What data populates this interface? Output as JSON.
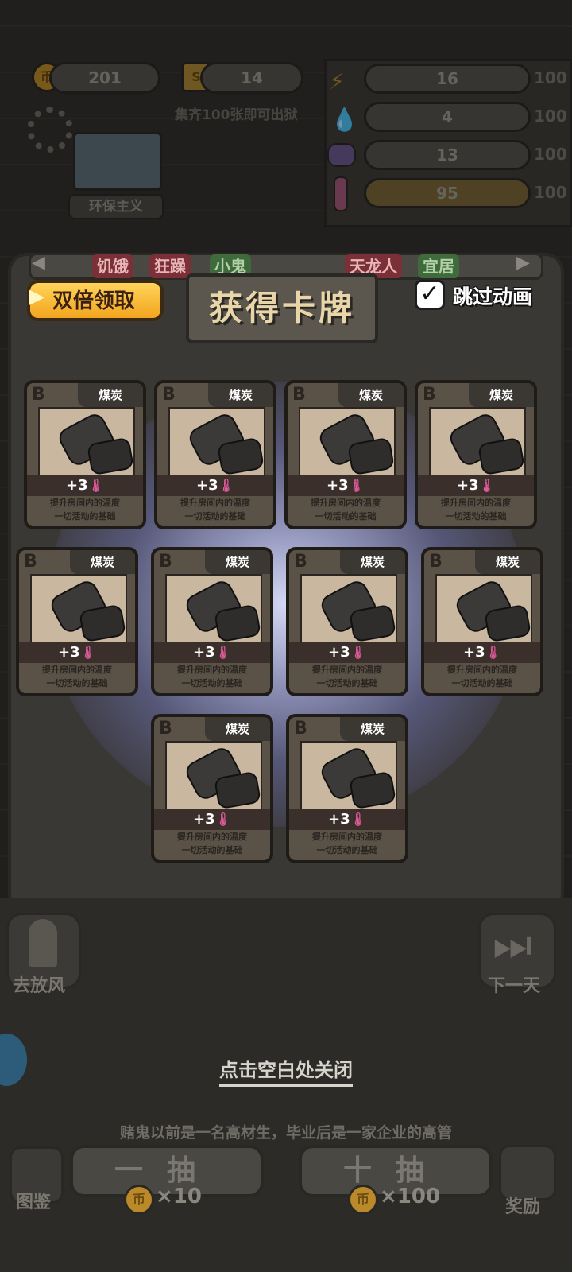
{
  "hud": {
    "coins": "201",
    "cards": "14",
    "collect_hint": "集齐100张即可出狱",
    "character_tag": "环保主义",
    "stats": [
      {
        "icon": "lightning-icon",
        "value": "16",
        "max": "100"
      },
      {
        "icon": "water-drop-icon",
        "value": "4",
        "max": "100"
      },
      {
        "icon": "brain-icon",
        "value": "13",
        "max": "100"
      },
      {
        "icon": "thermometer-icon",
        "value": "95",
        "max": "100"
      }
    ]
  },
  "tags": [
    "饥饿",
    "狂躁",
    "小鬼",
    "天龙人",
    "宜居"
  ],
  "popup": {
    "title": "获得卡牌",
    "double_reward": "双倍领取",
    "skip_animation": "跳过动画",
    "close_hint": "点击空白处关闭"
  },
  "cards": [
    {
      "grade": "B",
      "name": "煤炭",
      "effect": "+3",
      "desc1": "提升房间内的温度",
      "desc2": "一切活动的基础"
    },
    {
      "grade": "B",
      "name": "煤炭",
      "effect": "+3",
      "desc1": "提升房间内的温度",
      "desc2": "一切活动的基础"
    },
    {
      "grade": "B",
      "name": "煤炭",
      "effect": "+3",
      "desc1": "提升房间内的温度",
      "desc2": "一切活动的基础"
    },
    {
      "grade": "B",
      "name": "煤炭",
      "effect": "+3",
      "desc1": "提升房间内的温度",
      "desc2": "一切活动的基础"
    },
    {
      "grade": "B",
      "name": "煤炭",
      "effect": "+3",
      "desc1": "提升房间内的温度",
      "desc2": "一切活动的基础"
    },
    {
      "grade": "B",
      "name": "煤炭",
      "effect": "+3",
      "desc1": "提升房间内的温度",
      "desc2": "一切活动的基础"
    },
    {
      "grade": "B",
      "name": "煤炭",
      "effect": "+3",
      "desc1": "提升房间内的温度",
      "desc2": "一切活动的基础"
    },
    {
      "grade": "B",
      "name": "煤炭",
      "effect": "+3",
      "desc1": "提升房间内的温度",
      "desc2": "一切活动的基础"
    },
    {
      "grade": "B",
      "name": "煤炭",
      "effect": "+3",
      "desc1": "提升房间内的温度",
      "desc2": "一切活动的基础"
    },
    {
      "grade": "B",
      "name": "煤炭",
      "effect": "+3",
      "desc1": "提升房间内的温度",
      "desc2": "一切活动的基础"
    }
  ],
  "bottom": {
    "go_out": "去放风",
    "next_day": "下一天",
    "story": "赌鬼以前是一名高材生，毕业后是一家企业的高管",
    "draw_one": "一抽",
    "draw_ten": "十抽",
    "cost_one": "×10",
    "cost_ten": "×100",
    "codex": "图鉴",
    "reward": "奖励"
  },
  "colors": {
    "accent_gold": "#f3a51e",
    "card_effect_pink": "#e05a9a",
    "glow": "#b4b9f0"
  }
}
